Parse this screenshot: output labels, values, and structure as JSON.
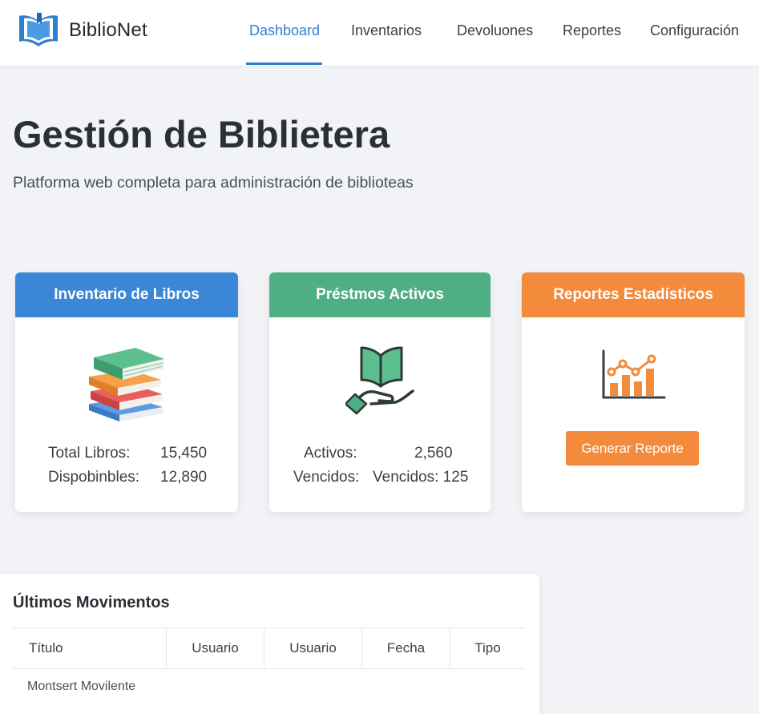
{
  "app": {
    "name": "BiblioNet",
    "logo_icon": "open-book-logo-icon"
  },
  "nav": {
    "items": [
      {
        "label": "Dashboard",
        "active": true
      },
      {
        "label": "Inventarios",
        "active": false
      },
      {
        "label": "Devoluones",
        "active": false
      },
      {
        "label": "Reportes",
        "active": false
      },
      {
        "label": "Configuración",
        "active": false
      }
    ]
  },
  "hero": {
    "title": "Gestión de Biblietera",
    "subtitle": "Platforma web completa para administración de biblioteas"
  },
  "cards": {
    "inventory": {
      "title": "Inventario de Libros",
      "color": "#3b86d6",
      "icon": "book-stack-icon",
      "total_label": "Total Libros:",
      "total_value": "15,450",
      "available_label": "Dispobinbles:",
      "available_value": "12,890"
    },
    "loans": {
      "title": "Préstmos Activos",
      "color": "#4fae84",
      "icon": "hand-holding-book-icon",
      "active_label": "Activos:",
      "active_value": "2,560",
      "overdue_label": "Vencidos:",
      "overdue_value": "Vencidos: 125"
    },
    "reports": {
      "title": "Reportes Estadísticos",
      "color": "#f48a3c",
      "icon": "bar-line-chart-icon",
      "button_label": "Generar Reporte"
    }
  },
  "movements": {
    "title": "Últimos Movimentos",
    "columns": [
      "Título",
      "Usuario",
      "Usuario",
      "Fecha",
      "Tipo"
    ],
    "rows": [
      [
        "Montsert Movilente"
      ]
    ]
  }
}
